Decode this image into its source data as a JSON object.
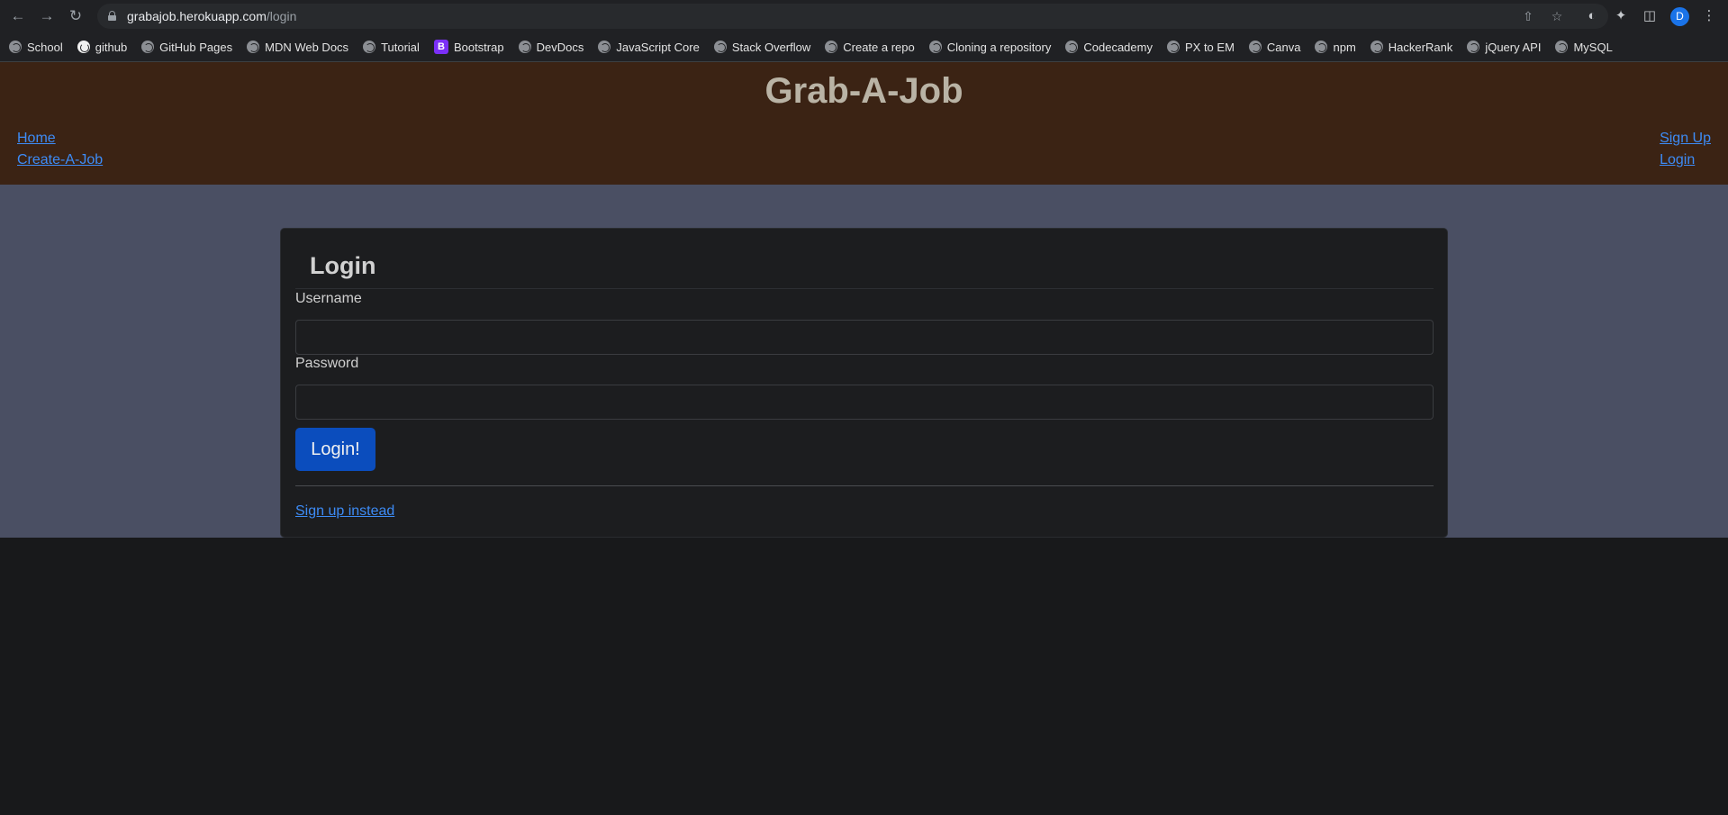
{
  "browser": {
    "url_host": "grabajob.herokuapp.com",
    "url_path": "/login",
    "profile_initial": "D"
  },
  "bookmarks": [
    {
      "label": "School",
      "icon": "globe-icon"
    },
    {
      "label": "github",
      "icon": "github-icon"
    },
    {
      "label": "GitHub Pages",
      "icon": "globe-icon"
    },
    {
      "label": "MDN Web Docs",
      "icon": "globe-icon"
    },
    {
      "label": "Tutorial",
      "icon": "globe-icon"
    },
    {
      "label": "Bootstrap",
      "icon": "bootstrap-icon"
    },
    {
      "label": "DevDocs",
      "icon": "globe-icon"
    },
    {
      "label": "JavaScript Core",
      "icon": "globe-icon"
    },
    {
      "label": "Stack Overflow",
      "icon": "globe-icon"
    },
    {
      "label": "Create a repo",
      "icon": "globe-icon"
    },
    {
      "label": "Cloning a repository",
      "icon": "globe-icon"
    },
    {
      "label": "Codecademy",
      "icon": "globe-icon"
    },
    {
      "label": "PX to EM",
      "icon": "globe-icon"
    },
    {
      "label": "Canva",
      "icon": "globe-icon"
    },
    {
      "label": "npm",
      "icon": "globe-icon"
    },
    {
      "label": "HackerRank",
      "icon": "globe-icon"
    },
    {
      "label": "jQuery API",
      "icon": "globe-icon"
    },
    {
      "label": "MySQL",
      "icon": "globe-icon"
    }
  ],
  "header": {
    "title": "Grab-A-Job",
    "nav_left": [
      "Home",
      "Create-A-Job"
    ],
    "nav_right": [
      "Sign Up",
      "Login"
    ]
  },
  "login": {
    "title": "Login",
    "username_label": "Username",
    "username_value": "",
    "password_label": "Password",
    "password_value": "",
    "submit_label": "Login!",
    "signup_link": "Sign up instead"
  },
  "colors": {
    "header_bg": "#3b2314",
    "band_bg": "#4a4f63",
    "page_bg": "#18191b",
    "card_bg": "#1c1d1f",
    "link": "#3d8bf5",
    "button": "#0b4dbd"
  }
}
